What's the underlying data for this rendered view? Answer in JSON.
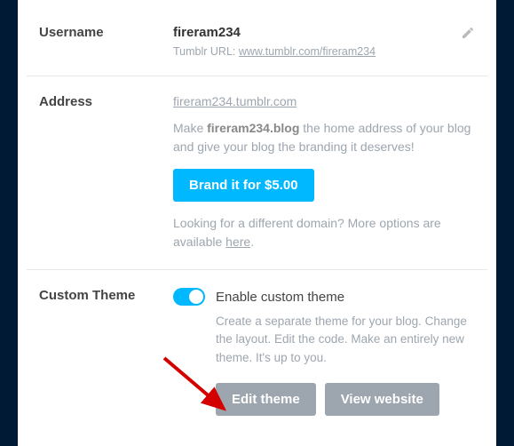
{
  "username": {
    "label": "Username",
    "value": "fireram234",
    "url_label": "Tumblr URL:",
    "url": "www.tumblr.com/fireram234"
  },
  "address": {
    "label": "Address",
    "domain": "fireram234.tumblr.com",
    "desc_prefix": "Make ",
    "desc_bold": "fireram234.blog",
    "desc_suffix": " the home address of your blog and give your blog the branding it deserves!",
    "brand_btn": "Brand it for $5.00",
    "more_prefix": "Looking for a different domain? More options are available ",
    "more_link": "here",
    "more_suffix": "."
  },
  "theme": {
    "label": "Custom Theme",
    "toggle_label": "Enable custom theme",
    "desc": "Create a separate theme for your blog. Change the layout. Edit the code. Make an entirely new theme. It's up to you.",
    "edit_btn": "Edit theme",
    "view_btn": "View website"
  }
}
